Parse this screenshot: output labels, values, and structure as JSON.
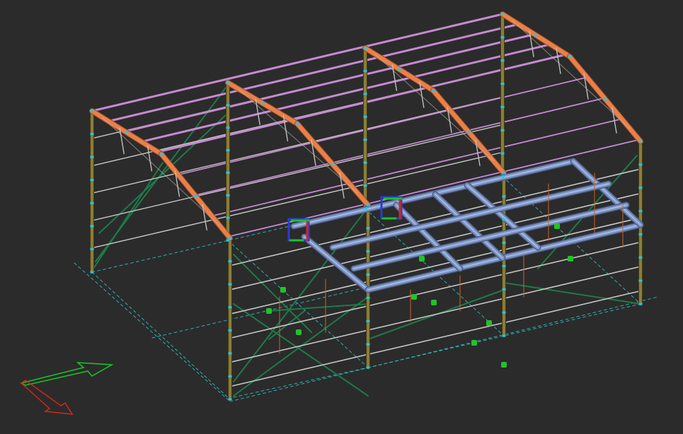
{
  "viewport": {
    "background": "#2b2b2b",
    "view": "isometric-3d-structural-model"
  },
  "colors": {
    "column": "#8a7d3a",
    "column_edge": "#3f3a16",
    "rafter": "#e8804a",
    "rafter_edge": "#a04a20",
    "purlin": "#c58ad0",
    "girt": "#c6c6c6",
    "truss": "#bfbfbf",
    "bracing": "#1e7a4a",
    "mezzanine_beam": "#7f96c8",
    "mezzanine_inner": "#cfe0f5",
    "grid_line": "#2fc6c6",
    "node": "#1ec8e6",
    "support": "#22c22a",
    "load_line": "#c86420",
    "axis_x": "#18c42a",
    "axis_y": "#d2281e",
    "axis_z": "#2a3cd2"
  },
  "axes_triad": {
    "x_axis": "green-arrow",
    "y_axis": "red-arrow"
  },
  "gizmos": [
    {
      "name": "coordinate-gizmo-1"
    },
    {
      "name": "coordinate-gizmo-2"
    }
  ]
}
